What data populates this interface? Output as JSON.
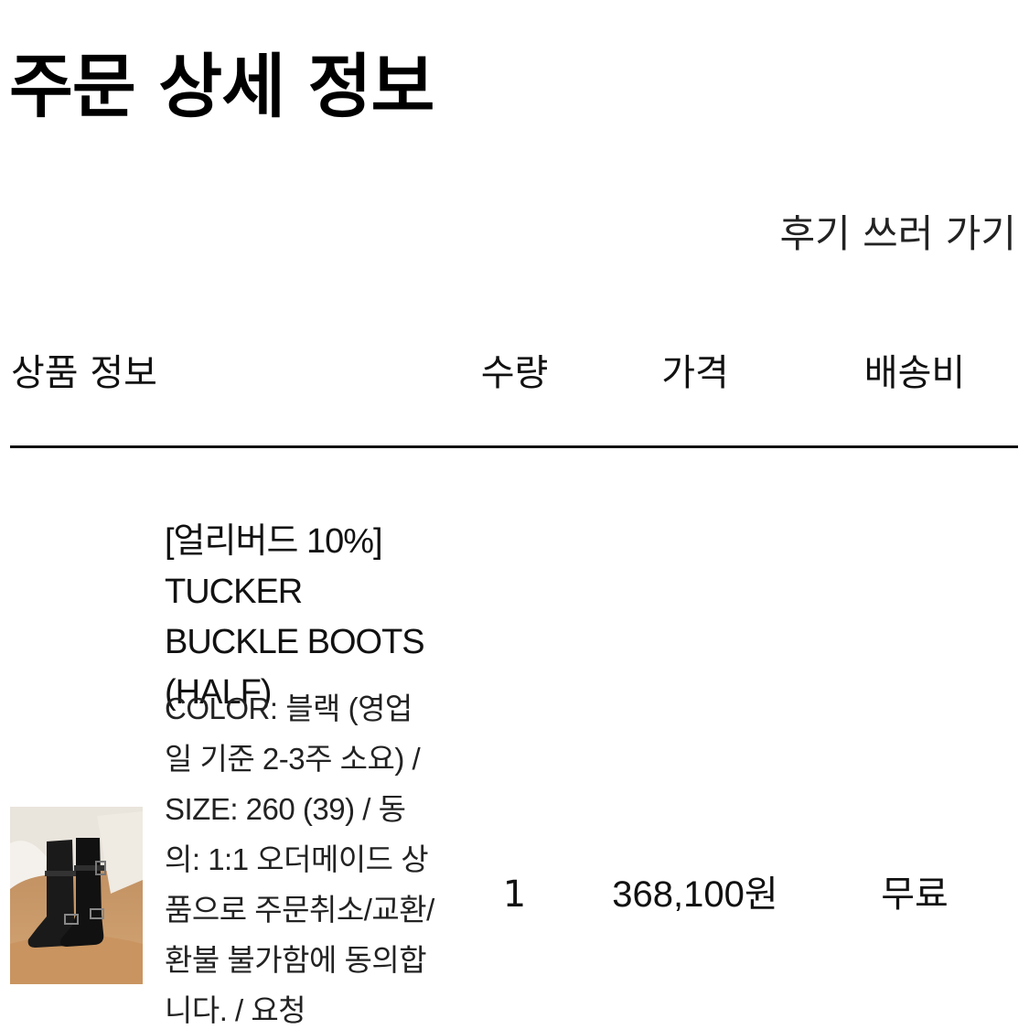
{
  "page": {
    "title": "주문 상세 정보",
    "review_link": "후기 쓰러 가기"
  },
  "table": {
    "headers": {
      "product": "상품 정보",
      "quantity": "수량",
      "price": "가격",
      "shipping": "배송비"
    },
    "rows": [
      {
        "name": "[얼리버드 10%] TUCKER BUCKLE BOOTS (HALF)",
        "option": "COLOR: 블랙 (영업일 기준 2-3주 소요) / SIZE: 260 (39) / 동의: 1:1 오더메이드 상품으로 주문취소/교환/환불 불가함에 동의합니다. / 요청",
        "quantity": "1",
        "price": "368,100원",
        "shipping": "무료",
        "thumbnail_icon": "black-buckle-boots-photo"
      }
    ]
  },
  "colors": {
    "text": "#111111",
    "background": "#ffffff",
    "rule": "#111111"
  }
}
